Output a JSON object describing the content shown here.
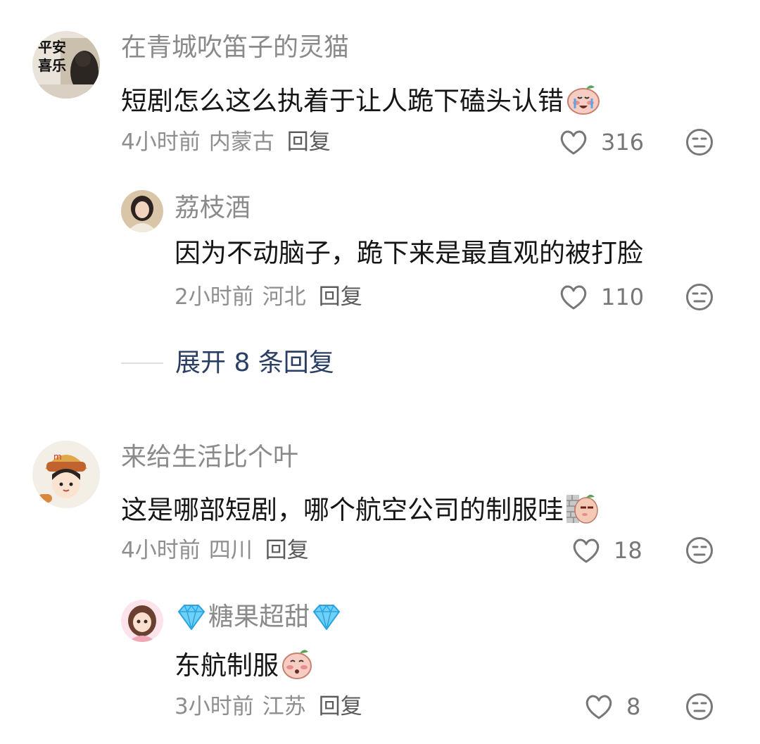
{
  "comments": [
    {
      "username": "在青城吹笛子的灵猫",
      "text": "短剧怎么这么执着于让人跪下磕头认错",
      "time": "4小时前",
      "location": "内蒙古",
      "reply_label": "回复",
      "likes": "316",
      "avatar_text": "平安喜乐",
      "emoji": "crying-face-sticker",
      "replies": [
        {
          "username": "荔枝酒",
          "text": "因为不动脑子，跪下来是最直观的被打脸",
          "time": "2小时前",
          "location": "河北",
          "reply_label": "回复",
          "likes": "110"
        }
      ],
      "expand_label": "展开 8 条回复"
    },
    {
      "username": "来给生活比个叶",
      "text": "这是哪部短剧，哪个航空公司的制服哇",
      "time": "4小时前",
      "location": "四川",
      "reply_label": "回复",
      "likes": "18",
      "emoji": "peeking-sticker",
      "replies": [
        {
          "username": "糖果超甜",
          "text": "东航制服",
          "time": "3小时前",
          "location": "江苏",
          "reply_label": "回复",
          "likes": "8",
          "emoji": "shy-sticker"
        }
      ]
    }
  ],
  "colors": {
    "username": "#8a8a8a",
    "text": "#161616",
    "meta": "#8e8e8e",
    "expand": "#2b3f66"
  }
}
